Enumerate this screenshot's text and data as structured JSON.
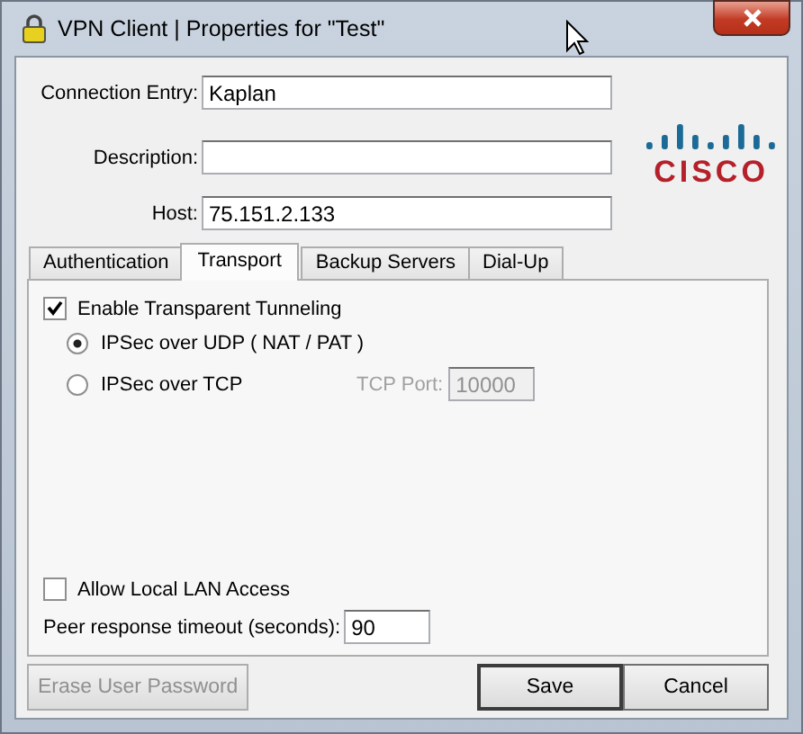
{
  "window": {
    "title": "VPN Client  |  Properties for \"Test\""
  },
  "fields": [
    {
      "label": "Connection Entry:",
      "value": "Kaplan"
    },
    {
      "label": "Description:"
    },
    {
      "label": "Host:",
      "value": "75.151.2.133"
    }
  ],
  "logo": {
    "text": "CISCO"
  },
  "tabs": [
    {
      "label": "Authentication",
      "selected": false
    },
    {
      "label": "Transport",
      "selected": true
    },
    {
      "label": "Backup Servers",
      "selected": false
    },
    {
      "label": "Dial-Up",
      "selected": false
    }
  ],
  "transport": {
    "enable_tunneling": {
      "label": "Enable Transparent Tunneling",
      "checked": true
    },
    "options": [
      {
        "label": "IPSec over UDP ( NAT / PAT )",
        "selected": true
      },
      {
        "label": "IPSec over TCP",
        "selected": false
      }
    ],
    "tcp_port": {
      "label": "TCP Port:",
      "value": "10000",
      "disabled": true
    }
  },
  "allow_lan": {
    "label": "Allow Local LAN Access",
    "checked": false
  },
  "timeout": {
    "label": "Peer response timeout (seconds):",
    "value": "90"
  },
  "buttons": [
    {
      "label": "Erase User Password",
      "disabled": true
    },
    {
      "label": "Save",
      "disabled": false
    },
    {
      "label": "Cancel",
      "disabled": false
    }
  ]
}
